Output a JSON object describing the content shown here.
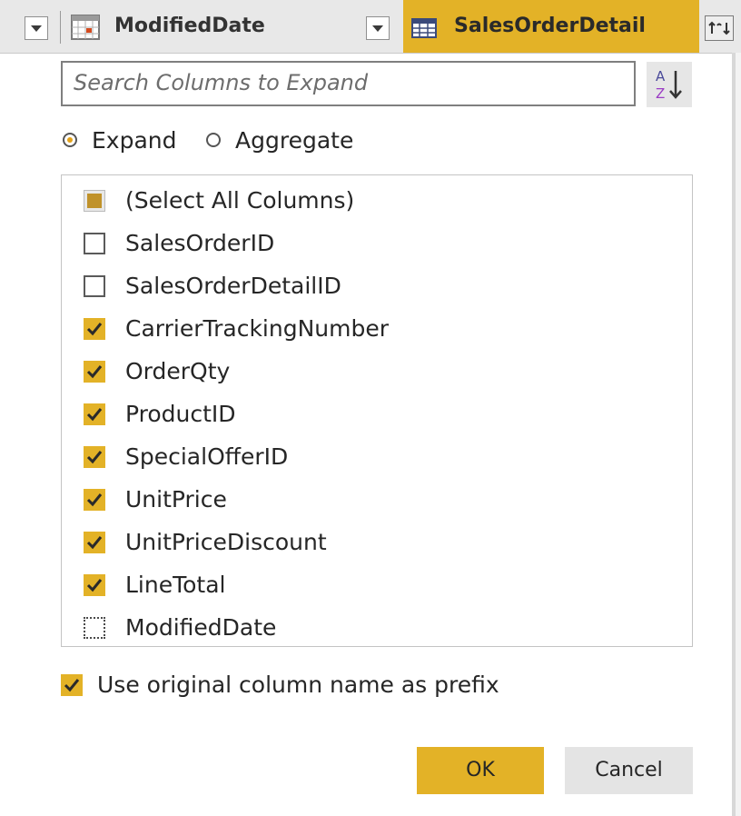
{
  "header": {
    "column_left_label": "ModifiedDate",
    "column_active_label": "SalesOrderDetail",
    "column_left_icon": "calendar-icon",
    "column_active_icon": "table-icon",
    "expand_icon": "expand-arrows-icon",
    "accent_color": "#e3b227"
  },
  "search": {
    "placeholder": "Search Columns to Expand",
    "sort_icon": "sort-az-icon"
  },
  "mode": {
    "expand_label": "Expand",
    "aggregate_label": "Aggregate",
    "selected": "Expand"
  },
  "columns": {
    "select_all_label": "(Select All Columns)",
    "select_all_state": "partial",
    "items": [
      {
        "label": "SalesOrderID",
        "checked": false
      },
      {
        "label": "SalesOrderDetailID",
        "checked": false
      },
      {
        "label": "CarrierTrackingNumber",
        "checked": true
      },
      {
        "label": "OrderQty",
        "checked": true
      },
      {
        "label": "ProductID",
        "checked": true
      },
      {
        "label": "SpecialOfferID",
        "checked": true
      },
      {
        "label": "UnitPrice",
        "checked": true
      },
      {
        "label": "UnitPriceDiscount",
        "checked": true
      },
      {
        "label": "LineTotal",
        "checked": true
      },
      {
        "label": "ModifiedDate",
        "checked": false
      }
    ]
  },
  "prefix": {
    "label": "Use original column name as prefix",
    "checked": true
  },
  "buttons": {
    "ok_label": "OK",
    "cancel_label": "Cancel"
  }
}
